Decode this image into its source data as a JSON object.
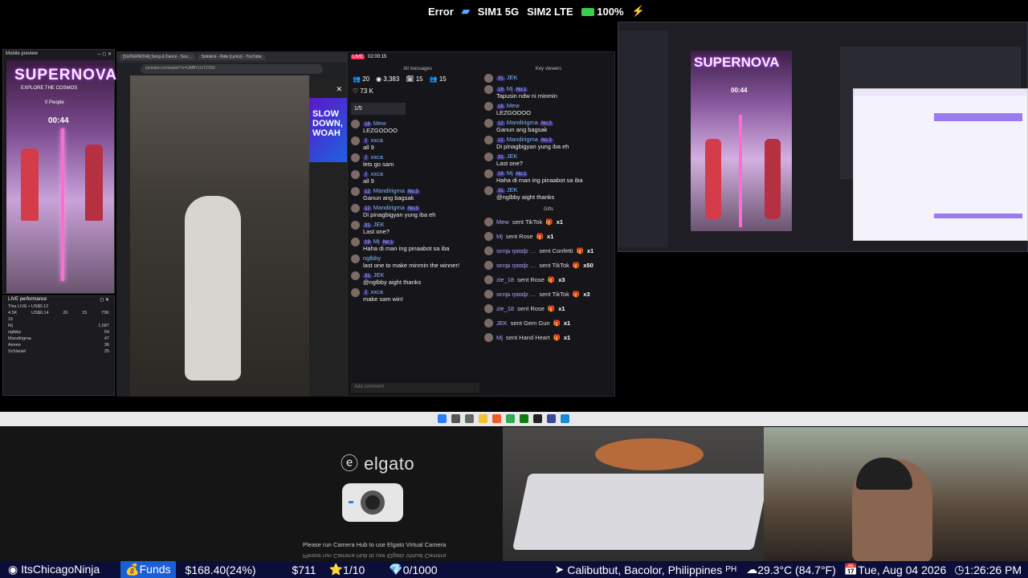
{
  "status_bar": {
    "error": "Error",
    "sim1": "SIM1 5G",
    "sim2": "SIM2 LTE",
    "battery": "100%"
  },
  "mobile_preview": {
    "title": "Mobile preview",
    "banner": "SUPERNOVA",
    "subtitle": "EXPLORE THE COSMOS",
    "people": "0 People",
    "timer": "00:44"
  },
  "live_performance": {
    "title": "LIVE performance",
    "subtitle": "This LIVE • US$0.12",
    "stats": [
      "4.5K",
      "US$0.14",
      "20",
      "15",
      "73K"
    ],
    "count": "15",
    "rows": [
      {
        "name": "Mj",
        "value": "1,587"
      },
      {
        "name": "nglbby",
        "value": "54"
      },
      {
        "name": "Mandirigma",
        "value": "47"
      },
      {
        "name": "Aeeee",
        "value": "36"
      },
      {
        "name": "Schlaniel",
        "value": "25"
      }
    ]
  },
  "browser": {
    "tab1": "[SUPERNOVA] Song & Dance - Sou…",
    "tab2": "Sidekick - Ride (Lyrics) - YouTube",
    "url": "youtube.com/watch?v=UMBVUzTZX50",
    "promo": "SLOW\nDOWN, WOAH"
  },
  "chat": {
    "time": "02:00:15",
    "header": "All messages",
    "key_viewers": "Key viewers",
    "gifts_header": "Gifts",
    "stats": {
      "viewers": "20",
      "total": "3,383",
      "gifts": "15",
      "members": "15",
      "likes": "73 K"
    },
    "queue": "1/5",
    "input_placeholder": "Add comment",
    "left_messages": [
      {
        "badge": "18",
        "name": "Mew",
        "text": "LEZGOOOO"
      },
      {
        "badge": "7",
        "name": "xxca",
        "text": "all 9"
      },
      {
        "badge": "7",
        "name": "xxca",
        "text": "lets go sam"
      },
      {
        "badge": "7",
        "name": "xxca",
        "text": "all 9"
      },
      {
        "badge": "12",
        "name": "Mandirigma",
        "rank": "No.3",
        "text": "Ganun ang bagsak"
      },
      {
        "badge": "12",
        "name": "Mandirigma",
        "rank": "No.3",
        "text": "Di pinagbigyan yung iba eh"
      },
      {
        "badge": "31",
        "name": "JEK",
        "text": "Last one?"
      },
      {
        "badge": "19",
        "name": "Mj",
        "rank": "No.1",
        "text": "Haha di man ing pinaabot sa iba"
      },
      {
        "badge": "",
        "name": "nglbby",
        "text": "last one to make minmin the winner!"
      },
      {
        "badge": "31",
        "name": "JEK",
        "text": "@nglbby aight thanks"
      },
      {
        "badge": "7",
        "name": "xxca",
        "text": "make sam win!"
      }
    ],
    "right_messages": [
      {
        "badge": "31",
        "name": "JEK",
        "text": ""
      },
      {
        "badge": "19",
        "name": "Mj",
        "rank": "No.1",
        "text": "Tapusin ndw ni minmin"
      },
      {
        "badge": "18",
        "name": "Mew",
        "text": "LEZGOOOO"
      },
      {
        "badge": "12",
        "name": "Mandirigma",
        "rank": "No.3",
        "text": "Ganun ang bagsak"
      },
      {
        "badge": "12",
        "name": "Mandirigma",
        "rank": "No.3",
        "text": "Di pinagbigyan yung iba eh"
      },
      {
        "badge": "31",
        "name": "JEK",
        "text": "Last one?"
      },
      {
        "badge": "19",
        "name": "Mj",
        "rank": "No.1",
        "text": "Haha di man ing pinaabot sa iba"
      },
      {
        "badge": "31",
        "name": "JEK",
        "text": "@nglbby aight thanks"
      }
    ],
    "gifts": [
      {
        "who": "Mew",
        "gift": "sent TikTok",
        "qty": "x1"
      },
      {
        "who": "Mj",
        "gift": "sent Rose",
        "qty": "x1"
      },
      {
        "who": "sєnթ ŋɑɑɖƨ …",
        "gift": "sent Confetti",
        "qty": "x1"
      },
      {
        "who": "sєnթ ŋɑɑɖƨ …",
        "gift": "sent TikTok",
        "qty": "x50"
      },
      {
        "who": "zie_18",
        "gift": "sent Rose",
        "qty": "x3"
      },
      {
        "who": "sєnթ ŋɑɑɖƨ …",
        "gift": "sent TikTok",
        "qty": "x3"
      },
      {
        "who": "zie_18",
        "gift": "sent Rose",
        "qty": "x1"
      },
      {
        "who": "JEK",
        "gift": "sent Gem Gun",
        "qty": "x1"
      },
      {
        "who": "Mj",
        "gift": "sent Hand Heart",
        "qty": "x1"
      }
    ]
  },
  "obs": {
    "banner": "SUPERNOVA",
    "timer": "00:44"
  },
  "elgato": {
    "logo": "elgato",
    "note": "Please run Camera Hub to use Elgato Virtual Camera"
  },
  "ticker": {
    "channel": "ItsChicagoNinja",
    "funds_label": "Funds",
    "funds_value": "$168.40(24%)",
    "amount": "$711",
    "stars": "1/10",
    "gems": "0/1000",
    "location": "Calibutbut, Bacolor, Philippines",
    "country": "PH",
    "weather": "29.3°C (84.7°F)",
    "date": "Tue, Aug 04 2026",
    "time": "1:26:26 PM"
  },
  "colors": {
    "ticker_bg": "#0c0e3a",
    "funds_bg": "#1b5fd6",
    "battery": "#36d04b",
    "chat_bg": "#16161a"
  }
}
